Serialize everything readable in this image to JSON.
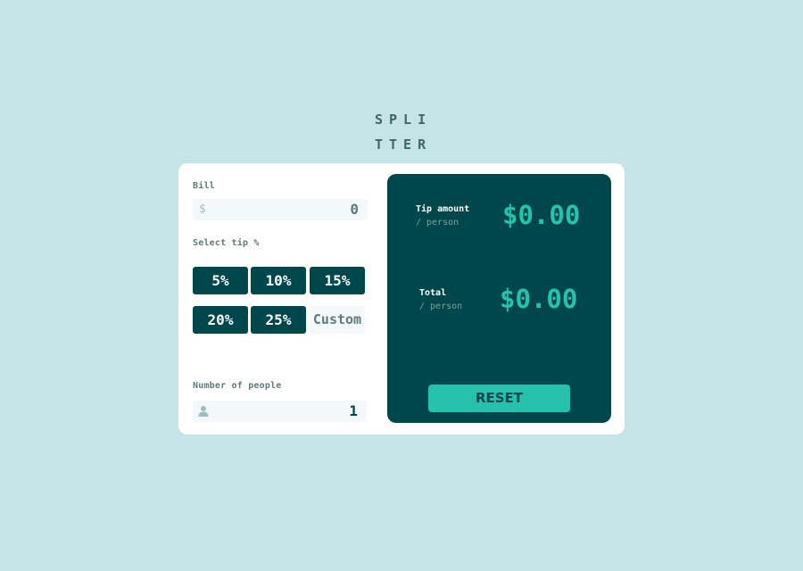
{
  "logo": {
    "line1": "SPLI",
    "line2": "TTER"
  },
  "bill": {
    "label": "Bill",
    "prefix": "$",
    "value": "0"
  },
  "tip": {
    "label": "Select tip %",
    "options": [
      "5%",
      "10%",
      "15%",
      "20%",
      "25%"
    ],
    "custom_label": "Custom"
  },
  "people": {
    "label": "Number of people",
    "value": "1"
  },
  "results": {
    "tip_label": "Tip amount",
    "tip_sub": "/ person",
    "tip_value": "$0.00",
    "total_label": "Total",
    "total_sub": "/ person",
    "total_value": "$0.00",
    "reset_label": "RESET"
  },
  "colors": {
    "background": "#c5e4e7",
    "dark_cyan": "#00474b",
    "strong_cyan": "#26c2ae",
    "card": "#ffffff"
  }
}
